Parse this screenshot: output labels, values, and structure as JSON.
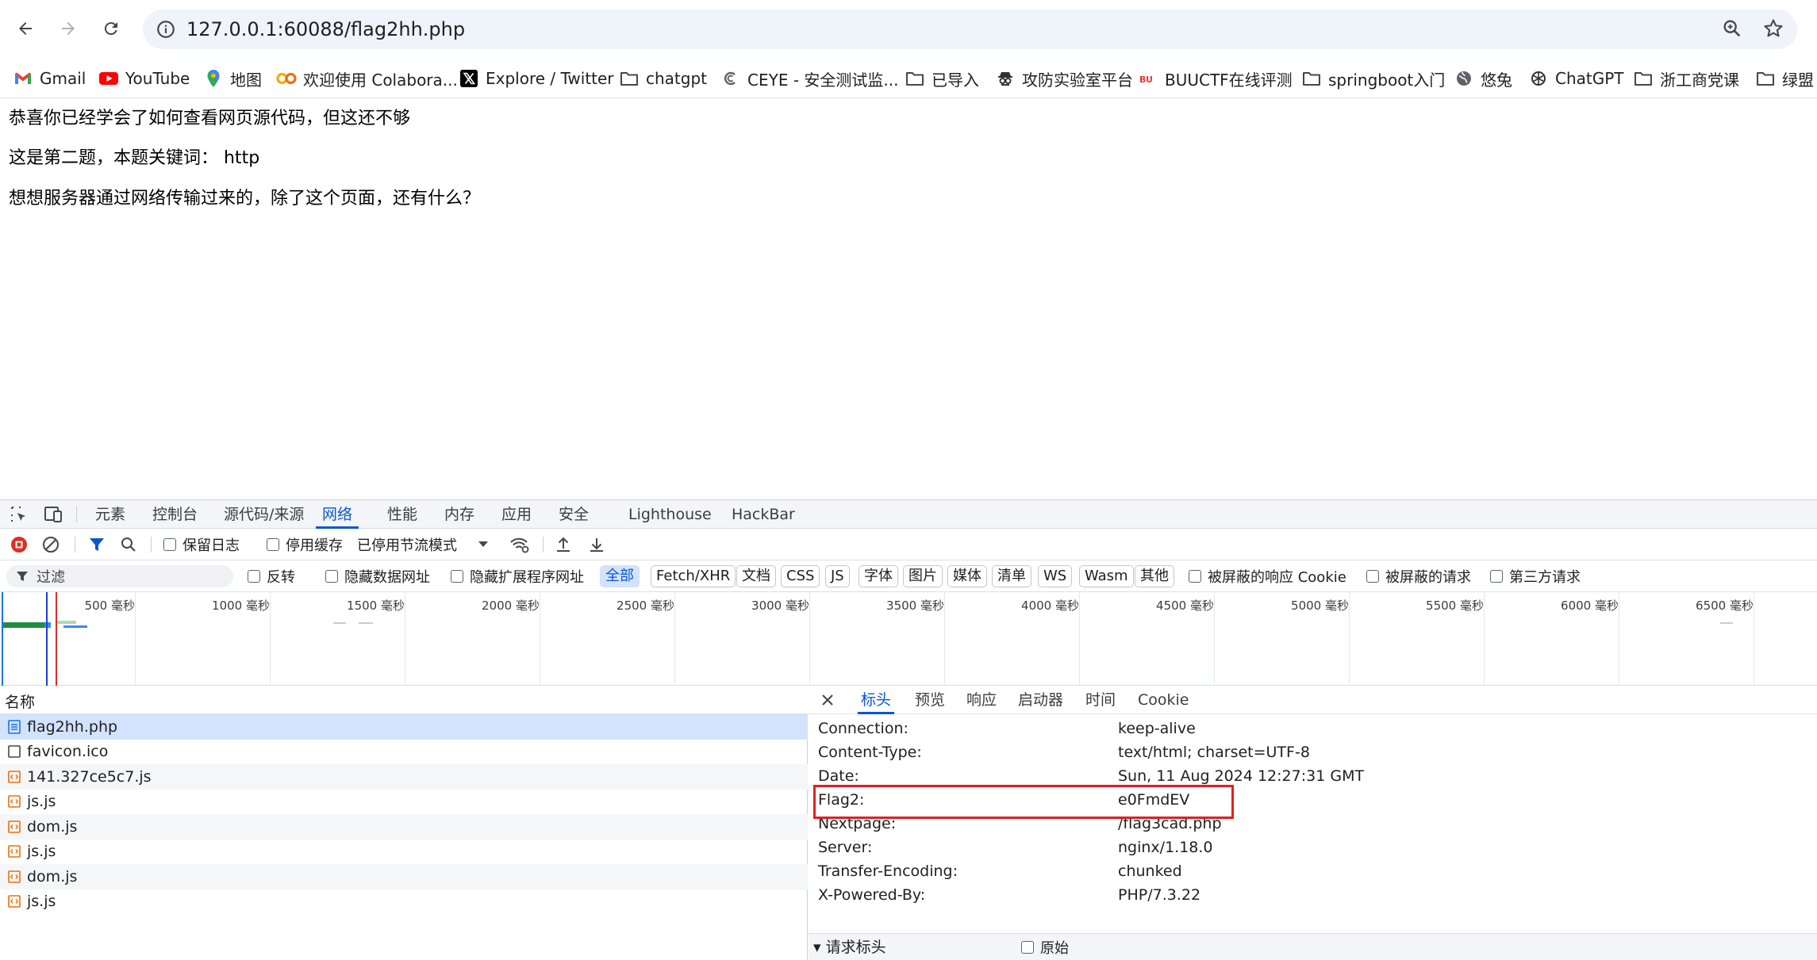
{
  "browser": {
    "url": "127.0.0.1:60088/flag2hh.php",
    "bookmarks": [
      {
        "label": "Gmail",
        "icon": "gmail-icon"
      },
      {
        "label": "YouTube",
        "icon": "youtube-icon"
      },
      {
        "label": "地图",
        "icon": "maps-icon"
      },
      {
        "label": "欢迎使用 Colabora...",
        "icon": "colab-icon"
      },
      {
        "label": "Explore / Twitter",
        "icon": "x-icon"
      },
      {
        "label": "chatgpt",
        "icon": "folder-icon"
      },
      {
        "label": "CEYE - 安全测试监...",
        "icon": "ceye-icon"
      },
      {
        "label": "已导入",
        "icon": "folder-icon"
      },
      {
        "label": "攻防实验室平台",
        "icon": "spy-icon"
      },
      {
        "label": "BUUCTF在线评测",
        "icon": "buuctf-icon"
      },
      {
        "label": "springboot入门",
        "icon": "folder-icon"
      },
      {
        "label": "悠兔",
        "icon": "globe-icon"
      },
      {
        "label": "ChatGPT",
        "icon": "openai-icon"
      },
      {
        "label": "浙工商党课",
        "icon": "folder-icon"
      },
      {
        "label": "绿盟",
        "icon": "folder-icon"
      }
    ]
  },
  "page": {
    "line1": "恭喜你已经学会了如何查看网页源代码，但这还不够",
    "line2": "这是第二题，本题关键词： http",
    "line3": "想想服务器通过网络传输过来的，除了这个页面，还有什么？"
  },
  "devtools": {
    "tabs": [
      "元素",
      "控制台",
      "源代码/来源",
      "网络",
      "性能",
      "内存",
      "应用",
      "安全",
      "Lighthouse",
      "HackBar"
    ],
    "active_tab": "网络",
    "toolbar": {
      "preserve_log": "保留日志",
      "disable_cache": "停用缓存",
      "throttle": "已停用节流模式"
    },
    "filter": {
      "placeholder": "过滤",
      "invert": "反转",
      "hide_data_urls": "隐藏数据网址",
      "hide_ext_urls": "隐藏扩展程序网址",
      "types": [
        "全部",
        "Fetch/XHR",
        "文档",
        "CSS",
        "JS",
        "字体",
        "图片",
        "媒体",
        "清单",
        "WS",
        "Wasm",
        "其他"
      ],
      "blocked_cookies": "被屏蔽的响应 Cookie",
      "blocked_requests": "被屏蔽的请求",
      "third_party": "第三方请求"
    },
    "timeline_ticks": [
      "500 毫秒",
      "1000 毫秒",
      "1500 毫秒",
      "2000 毫秒",
      "2500 毫秒",
      "3000 毫秒",
      "3500 毫秒",
      "4000 毫秒",
      "4500 毫秒",
      "5000 毫秒",
      "5500 毫秒",
      "6000 毫秒",
      "6500 毫秒"
    ],
    "requests_header": "名称",
    "requests": [
      {
        "name": "flag2hh.php",
        "type": "document",
        "selected": true
      },
      {
        "name": "favicon.ico",
        "type": "other"
      },
      {
        "name": "141.327ce5c7.js",
        "type": "script"
      },
      {
        "name": "js.js",
        "type": "script"
      },
      {
        "name": "dom.js",
        "type": "script"
      },
      {
        "name": "js.js",
        "type": "script"
      },
      {
        "name": "dom.js",
        "type": "script"
      },
      {
        "name": "js.js",
        "type": "script"
      }
    ],
    "detail_tabs": [
      "标头",
      "预览",
      "响应",
      "启动器",
      "时间",
      "Cookie"
    ],
    "response_headers": [
      {
        "name": "Connection:",
        "value": "keep-alive"
      },
      {
        "name": "Content-Type:",
        "value": "text/html; charset=UTF-8"
      },
      {
        "name": "Date:",
        "value": "Sun, 11 Aug 2024 12:27:31 GMT"
      },
      {
        "name": "Flag2:",
        "value": "e0FmdEV"
      },
      {
        "name": "Nextpage:",
        "value": "/flag3cad.php"
      },
      {
        "name": "Server:",
        "value": "nginx/1.18.0"
      },
      {
        "name": "Transfer-Encoding:",
        "value": "chunked"
      },
      {
        "name": "X-Powered-By:",
        "value": "PHP/7.3.22"
      }
    ],
    "request_headers_label": "▾ 请求标头",
    "raw_label": "原始",
    "colors": {
      "accent": "#0b57d0",
      "highlight": "#e02020"
    }
  }
}
